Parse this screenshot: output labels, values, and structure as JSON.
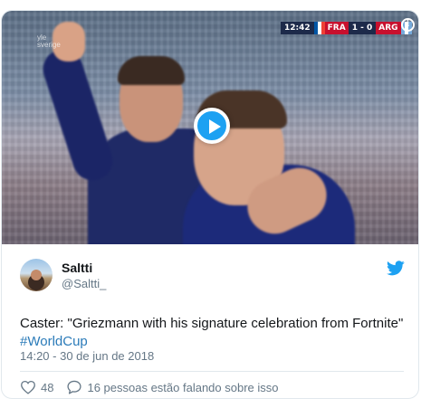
{
  "media": {
    "scoreboard": {
      "clock": "12:42",
      "team_home": "FRA",
      "score": "1 - 0",
      "team_away": "ARG",
      "flag_home_colors": [
        "#0055a4",
        "#ffffff",
        "#ef4135"
      ],
      "flag_away_colors": [
        "#75aadb",
        "#ffffff",
        "#75aadb"
      ]
    },
    "watermark": [
      "yle",
      "sverige"
    ],
    "info_icon": "info-icon",
    "play_icon": "play-icon"
  },
  "tweet": {
    "display_name": "Saltti",
    "handle": "@Saltti_",
    "text": "Caster: \"Griezmann with his signature celebration from Fortnite\"",
    "hashtag": "#WorldCup",
    "timestamp": "14:20 - 30 de jun de 2018",
    "likes": "48",
    "replies_text": "16 pessoas estão falando sobre isso"
  },
  "colors": {
    "twitter_blue": "#1da1f2",
    "link": "#2b7bb9",
    "muted": "#657786",
    "border": "#e1e8ed"
  }
}
